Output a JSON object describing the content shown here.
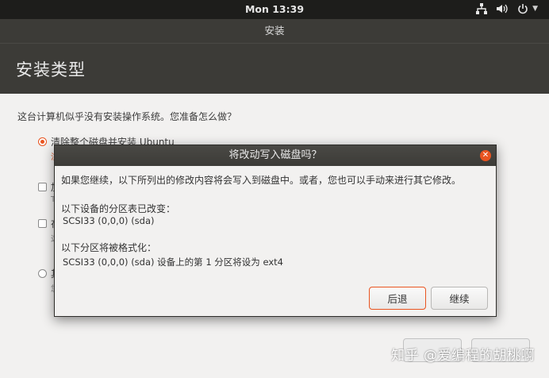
{
  "topbar": {
    "clock": "Mon 13:39",
    "icons": [
      "network-icon",
      "volume-icon",
      "power-icon",
      "chevron-down-icon"
    ]
  },
  "window": {
    "title": "安装"
  },
  "page": {
    "title": "安装类型"
  },
  "content": {
    "question": "这台计算机似乎没有安装操作系统。您准备怎么做？",
    "options": [
      {
        "label": "清除整个磁盘并安装 Ubuntu",
        "selected": true
      },
      {
        "label": "加",
        "type": "checkbox"
      },
      {
        "label": "在",
        "type": "checkbox"
      },
      {
        "label": "其",
        "type": "radio"
      }
    ],
    "option_subs": [
      "注",
      "T",
      "这",
      "您"
    ]
  },
  "dialog": {
    "title": "将改动写入磁盘吗？",
    "message": "如果您继续，以下所列出的修改内容将会写入到磁盘中。或者，您也可以手动来进行其它修改。",
    "partition_table_heading": "以下设备的分区表已改变：",
    "partition_table_device": "SCSI33 (0,0,0) (sda)",
    "format_heading": "以下分区将被格式化：",
    "format_detail": "SCSI33 (0,0,0) (sda) 设备上的第 1 分区将设为 ext4",
    "back_label": "后退",
    "continue_label": "继续"
  },
  "watermark": "知乎 @爱编程的胡桃啊",
  "colors": {
    "accent": "#e95420",
    "topbar": "#1d1d1b",
    "header": "#3c3b37",
    "body": "#f2f1f0"
  }
}
